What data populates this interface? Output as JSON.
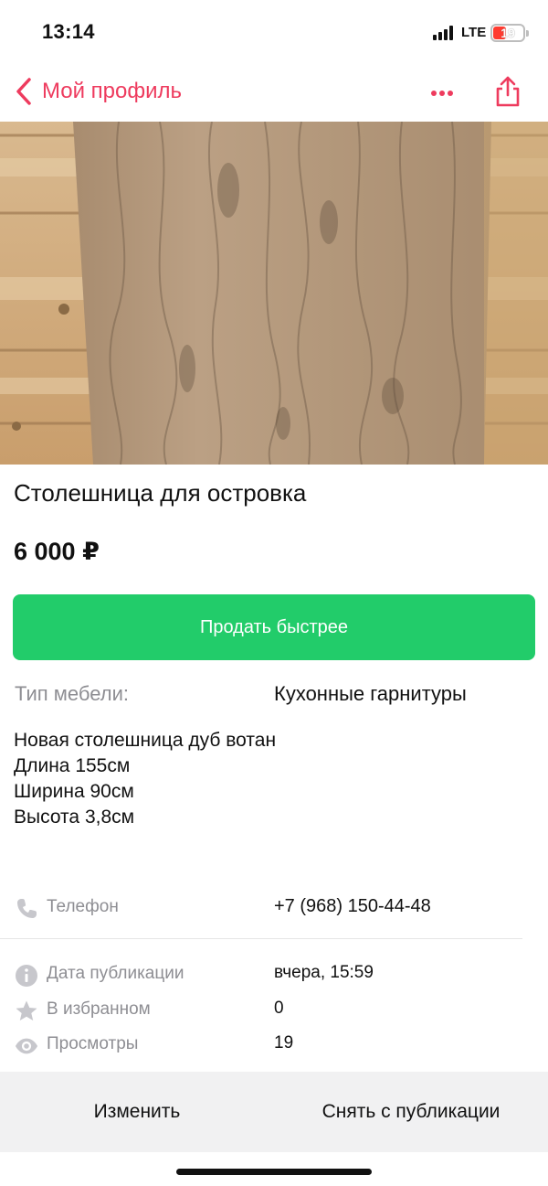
{
  "status_bar": {
    "time": "13:14",
    "network": "LTE",
    "battery": "19"
  },
  "nav": {
    "back_label": "Мой профиль",
    "more_icon": "more-dots-icon",
    "share_icon": "share-icon"
  },
  "listing": {
    "title": "Столешница для островка",
    "price": "6 000 ₽",
    "promote_button": "Продать быстрее",
    "param_label": "Тип мебели:",
    "param_value": "Кухонные гарнитуры",
    "description": [
      "Новая столешница дуб вотан",
      "Длина 155см",
      "Ширина 90см",
      "Высота 3,8см"
    ]
  },
  "contact": {
    "phone_label": "Телефон",
    "phone_value": "+7 (968) 150-44-48"
  },
  "stats": {
    "published_label": "Дата публикации",
    "published_value": "вчера, 15:59",
    "favorites_label": "В избранном",
    "favorites_value": "0",
    "views_label": "Просмотры",
    "views_value": "19"
  },
  "actions": {
    "edit": "Изменить",
    "unpublish": "Снять с публикации"
  },
  "colors": {
    "accent": "#ee3b5e",
    "promote": "#22cc6a",
    "muted": "#8e8e93",
    "action_bar": "#f1f1f2"
  }
}
